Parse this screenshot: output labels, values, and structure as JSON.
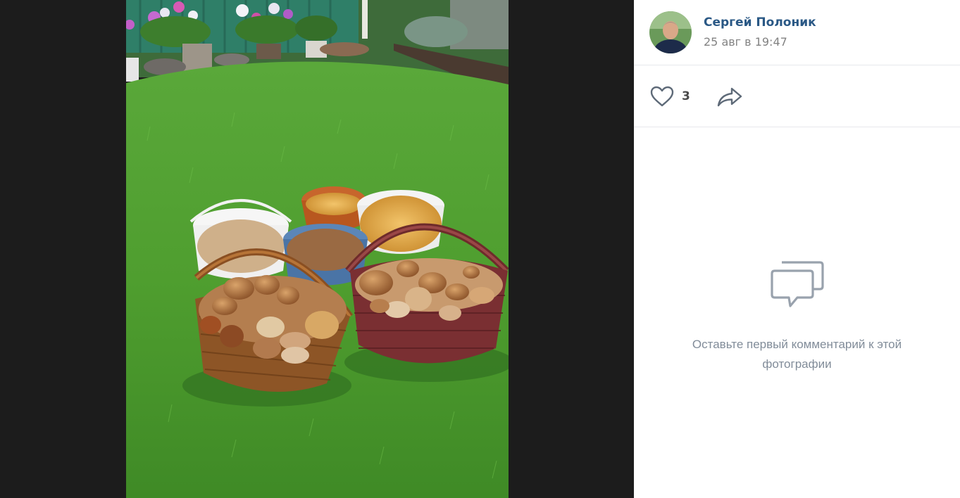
{
  "post": {
    "author_name": "Сергей Полоник",
    "date": "25 авг в 19:47",
    "avatar_icon": "user-avatar-photo",
    "photo_subject": "mushrooms-in-baskets-photo"
  },
  "actions": {
    "like_icon": "heart-outline-icon",
    "like_count": "3",
    "share_icon": "share-arrow-icon"
  },
  "comments": {
    "empty_icon": "speech-bubbles-icon",
    "empty_text": "Оставьте первый комментарий к этой фотографии"
  },
  "colors": {
    "link": "#2a5885",
    "secondary_text": "#828282",
    "icon": "#5e6a78",
    "empty_text": "#818c99",
    "divider": "#e7e8ec",
    "backdrop": "#212121"
  }
}
